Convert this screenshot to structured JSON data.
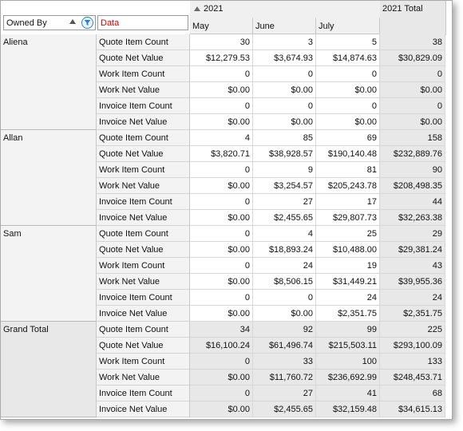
{
  "field_headers": {
    "owned_by": "Owned By",
    "data": "Data"
  },
  "column_header": {
    "year": "2021",
    "total": "2021 Total",
    "months": [
      "May",
      "June",
      "July"
    ]
  },
  "groups": [
    {
      "owner": "Aliena",
      "rows": [
        {
          "label": "Quote Item Count",
          "values": [
            "30",
            "3",
            "5"
          ],
          "total": "38"
        },
        {
          "label": "Quote Net Value",
          "values": [
            "$12,279.53",
            "$3,674.93",
            "$14,874.63"
          ],
          "total": "$30,829.09"
        },
        {
          "label": "Work Item Count",
          "values": [
            "0",
            "0",
            "0"
          ],
          "total": "0"
        },
        {
          "label": "Work Net Value",
          "values": [
            "$0.00",
            "$0.00",
            "$0.00"
          ],
          "total": "$0.00"
        },
        {
          "label": "Invoice Item Count",
          "values": [
            "0",
            "0",
            "0"
          ],
          "total": "0"
        },
        {
          "label": "Invoice Net Value",
          "values": [
            "$0.00",
            "$0.00",
            "$0.00"
          ],
          "total": "$0.00"
        }
      ]
    },
    {
      "owner": "Allan",
      "rows": [
        {
          "label": "Quote Item Count",
          "values": [
            "4",
            "85",
            "69"
          ],
          "total": "158"
        },
        {
          "label": "Quote Net Value",
          "values": [
            "$3,820.71",
            "$38,928.57",
            "$190,140.48"
          ],
          "total": "$232,889.76"
        },
        {
          "label": "Work Item Count",
          "values": [
            "0",
            "9",
            "81"
          ],
          "total": "90"
        },
        {
          "label": "Work Net Value",
          "values": [
            "$0.00",
            "$3,254.57",
            "$205,243.78"
          ],
          "total": "$208,498.35"
        },
        {
          "label": "Invoice Item Count",
          "values": [
            "0",
            "27",
            "17"
          ],
          "total": "44"
        },
        {
          "label": "Invoice Net Value",
          "values": [
            "$0.00",
            "$2,455.65",
            "$29,807.73"
          ],
          "total": "$32,263.38"
        }
      ]
    },
    {
      "owner": "Sam",
      "rows": [
        {
          "label": "Quote Item Count",
          "values": [
            "0",
            "4",
            "25"
          ],
          "total": "29"
        },
        {
          "label": "Quote Net Value",
          "values": [
            "$0.00",
            "$18,893.24",
            "$10,488.00"
          ],
          "total": "$29,381.24"
        },
        {
          "label": "Work Item Count",
          "values": [
            "0",
            "24",
            "19"
          ],
          "total": "43"
        },
        {
          "label": "Work Net Value",
          "values": [
            "$0.00",
            "$8,506.15",
            "$31,449.21"
          ],
          "total": "$39,955.36"
        },
        {
          "label": "Invoice Item Count",
          "values": [
            "0",
            "0",
            "24"
          ],
          "total": "24"
        },
        {
          "label": "Invoice Net Value",
          "values": [
            "$0.00",
            "$0.00",
            "$2,351.75"
          ],
          "total": "$2,351.75"
        }
      ]
    },
    {
      "owner": "Grand Total",
      "grand": true,
      "rows": [
        {
          "label": "Quote Item Count",
          "values": [
            "34",
            "92",
            "99"
          ],
          "total": "225"
        },
        {
          "label": "Quote Net Value",
          "values": [
            "$16,100.24",
            "$61,496.74",
            "$215,503.11"
          ],
          "total": "$293,100.09"
        },
        {
          "label": "Work Item Count",
          "values": [
            "0",
            "33",
            "100"
          ],
          "total": "133"
        },
        {
          "label": "Work Net Value",
          "values": [
            "$0.00",
            "$11,760.72",
            "$236,692.99"
          ],
          "total": "$248,453.71"
        },
        {
          "label": "Invoice Item Count",
          "values": [
            "0",
            "27",
            "41"
          ],
          "total": "68"
        },
        {
          "label": "Invoice Net Value",
          "values": [
            "$0.00",
            "$2,455.65",
            "$32,159.48"
          ],
          "total": "$34,615.13"
        }
      ]
    }
  ],
  "colors": {
    "data_field_text": "#d40000",
    "filter_icon": "#2b7fd0",
    "header_bg": "#f0f0f0",
    "total_bg": "#e8e8e8"
  }
}
